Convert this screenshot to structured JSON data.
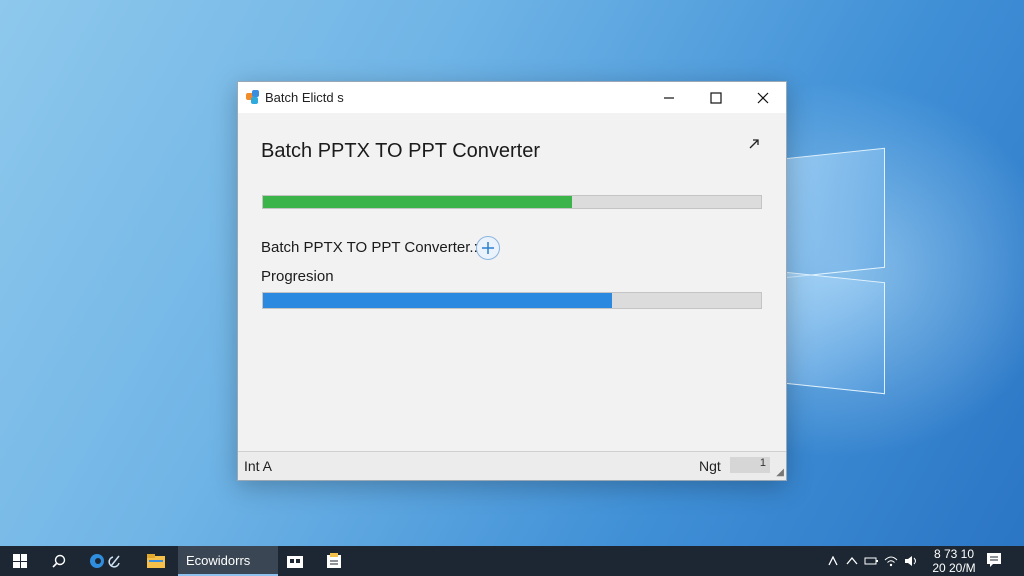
{
  "window": {
    "title": "Batch Elictd s",
    "heading": "Batch PPTX TO PPT Converter",
    "progress_main": 0.62,
    "task_label": "Batch PPTX TO PPT Converter.:",
    "progress_label": "Progresion",
    "progress_secondary": 0.7,
    "status_left": "Int A",
    "status_right": "Ngt",
    "status_box": "1"
  },
  "taskbar": {
    "active_task": "Ecowidorrs",
    "clock_line1": "8 73 10",
    "clock_line2": "20 20/M"
  },
  "colors": {
    "progress_green": "#3bb54a",
    "progress_blue": "#2b8ae0",
    "taskbar": "#1d2733"
  }
}
